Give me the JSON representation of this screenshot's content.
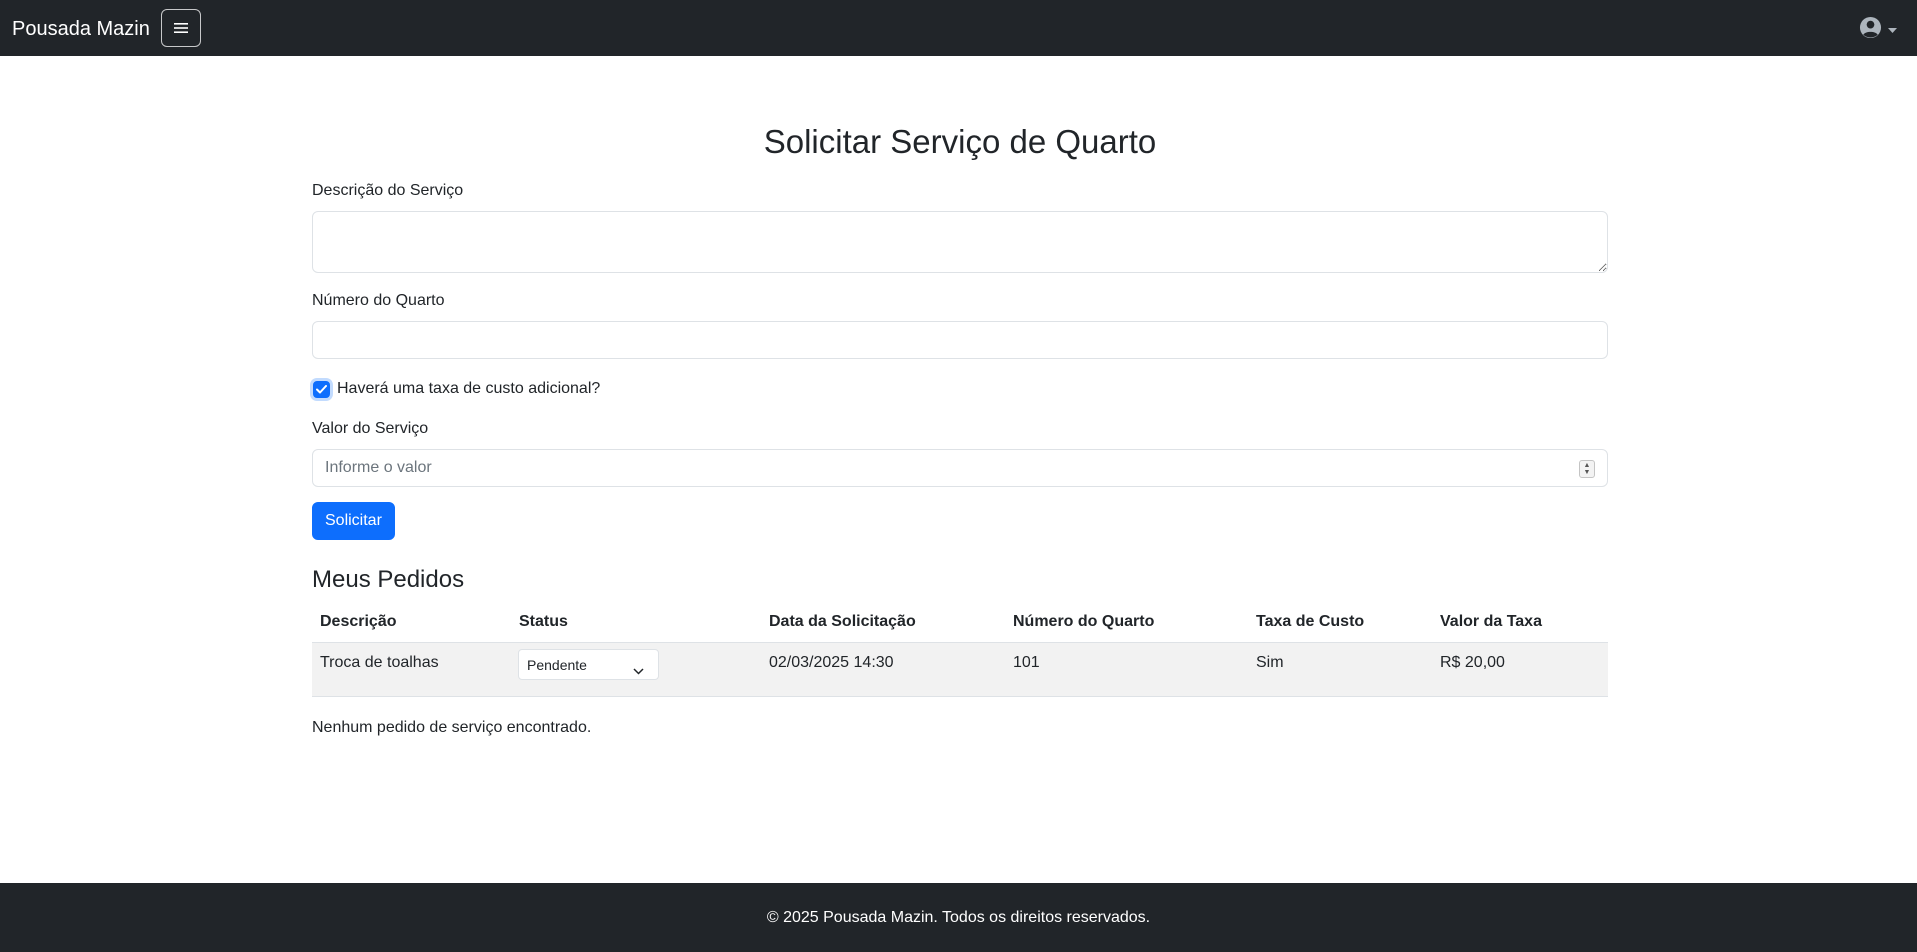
{
  "navbar": {
    "brand": "Pousada Mazin",
    "toggler_icon": "hamburger-icon",
    "user_icon": "user-circle-icon"
  },
  "form": {
    "title": "Solicitar Serviço de Quarto",
    "description_label": "Descrição do Serviço",
    "description_value": "",
    "room_label": "Número do Quarto",
    "room_value": "",
    "fee_checkbox_label": "Haverá uma taxa de custo adicional?",
    "fee_checked": true,
    "value_label": "Valor do Serviço",
    "value_placeholder": "Informe o valor",
    "submit_label": "Solicitar"
  },
  "orders": {
    "title": "Meus Pedidos",
    "columns": [
      "Descrição",
      "Status",
      "Data da Solicitação",
      "Número do Quarto",
      "Taxa de Custo",
      "Valor da Taxa"
    ],
    "rows": [
      {
        "descricao": "Troca de toalhas",
        "status": "Pendente",
        "data": "02/03/2025 14:30",
        "quarto": "101",
        "taxa": "Sim",
        "valor": "R$ 20,00"
      }
    ],
    "empty_message": "Nenhum pedido de serviço encontrado."
  },
  "footer": {
    "text": "© 2025 Pousada Mazin. Todos os direitos reservados."
  },
  "colors": {
    "navbar_bg": "#212529",
    "primary": "#0d6efd",
    "row_bg": "#f2f2f2"
  }
}
